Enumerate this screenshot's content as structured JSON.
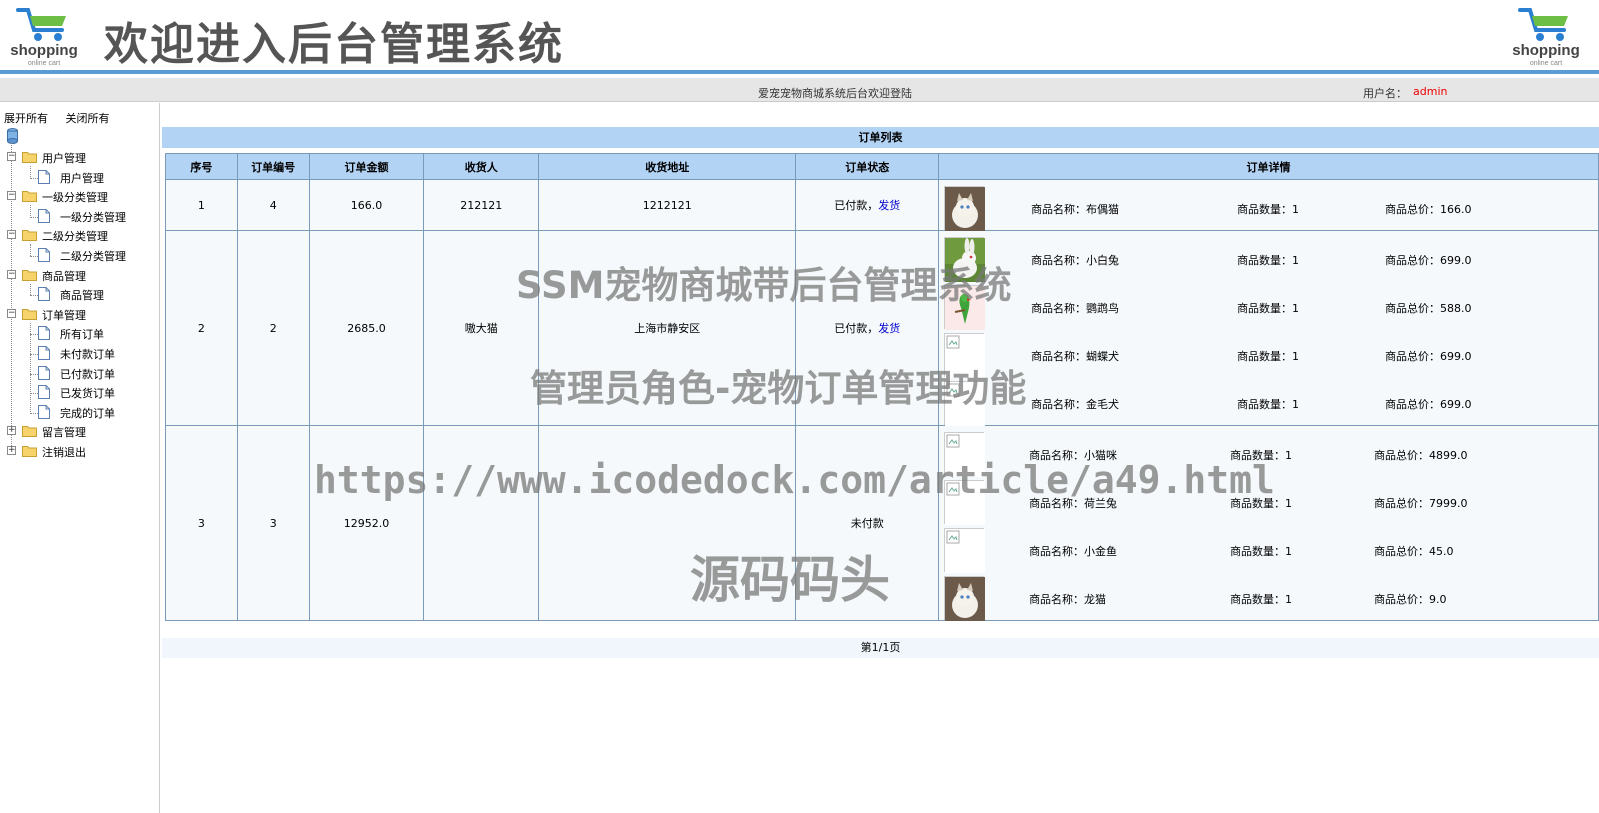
{
  "header": {
    "logo_text": "shopping",
    "logo_sub": "online cart",
    "title": "欢迎进入后台管理系统"
  },
  "welcome_bar": {
    "text": "爱宠宠物商城系统后台欢迎登陆",
    "user_label": "用户名：",
    "user_name": "admin"
  },
  "sidebar": {
    "expand_all": "展开所有",
    "collapse_all": "关闭所有",
    "groups": [
      {
        "label": "用户管理",
        "children": [
          "用户管理"
        ]
      },
      {
        "label": "一级分类管理",
        "children": [
          "一级分类管理"
        ]
      },
      {
        "label": "二级分类管理",
        "children": [
          "二级分类管理"
        ]
      },
      {
        "label": "商品管理",
        "children": [
          "商品管理"
        ]
      },
      {
        "label": "订单管理",
        "children": [
          "所有订单",
          "未付款订单",
          "已付款订单",
          "已发货订单",
          "完成的订单"
        ]
      },
      {
        "label": "留言管理",
        "children": []
      },
      {
        "label": "注销退出",
        "children": []
      }
    ]
  },
  "orders": {
    "title": "订单列表",
    "columns": [
      "序号",
      "订单编号",
      "订单金额",
      "收货人",
      "收货地址",
      "订单状态",
      "订单详情"
    ],
    "rows": [
      {
        "seq": "1",
        "order_no": "4",
        "amount": "166.0",
        "receiver": "212121",
        "address": "1212121",
        "status": "已付款，",
        "action": "发货",
        "items": [
          {
            "name": "商品名称：布偶猫",
            "qty": "商品数量：1",
            "total": "商品总价：166.0",
            "img": "cat"
          }
        ]
      },
      {
        "seq": "2",
        "order_no": "2",
        "amount": "2685.0",
        "receiver": "嗷大猫",
        "address": "上海市静安区",
        "status": "已付款，",
        "action": "发货",
        "items": [
          {
            "name": "商品名称：小白兔",
            "qty": "商品数量：1",
            "total": "商品总价：699.0",
            "img": "rabbit"
          },
          {
            "name": "商品名称：鹦鹉鸟",
            "qty": "商品数量：1",
            "total": "商品总价：588.0",
            "img": "parrot"
          },
          {
            "name": "商品名称：蝴蝶犬",
            "qty": "商品数量：1",
            "total": "商品总价：699.0",
            "img": "broken"
          },
          {
            "name": "商品名称：金毛犬",
            "qty": "商品数量：1",
            "total": "商品总价：699.0",
            "img": "broken"
          }
        ]
      },
      {
        "seq": "3",
        "order_no": "3",
        "amount": "12952.0",
        "receiver": "",
        "address": "",
        "status": "未付款",
        "action": "",
        "items": [
          {
            "name": "商品名称：小猫咪",
            "qty": "商品数量：1",
            "total": "商品总价：4899.0",
            "img": "broken"
          },
          {
            "name": "商品名称：荷兰兔",
            "qty": "商品数量：1",
            "total": "商品总价：7999.0",
            "img": "broken"
          },
          {
            "name": "商品名称：小金鱼",
            "qty": "商品数量：1",
            "total": "商品总价：45.0",
            "img": "broken"
          },
          {
            "name": "商品名称：龙猫",
            "qty": "商品数量：1",
            "total": "商品总价：9.0",
            "img": "cat"
          }
        ]
      }
    ],
    "pager": "第1/1页"
  },
  "watermark": {
    "line1": "SSM宠物商城带后台管理系统",
    "line2": "管理员角色-宠物订单管理功能",
    "line3": "https://www.icodedock.com/article/a49.html",
    "line4": "源码码头"
  },
  "colors": {
    "header_border": "#5b9bd5",
    "table_header": "#b3d3f5",
    "user_name": "#ee0000",
    "link": "#0000cc"
  }
}
